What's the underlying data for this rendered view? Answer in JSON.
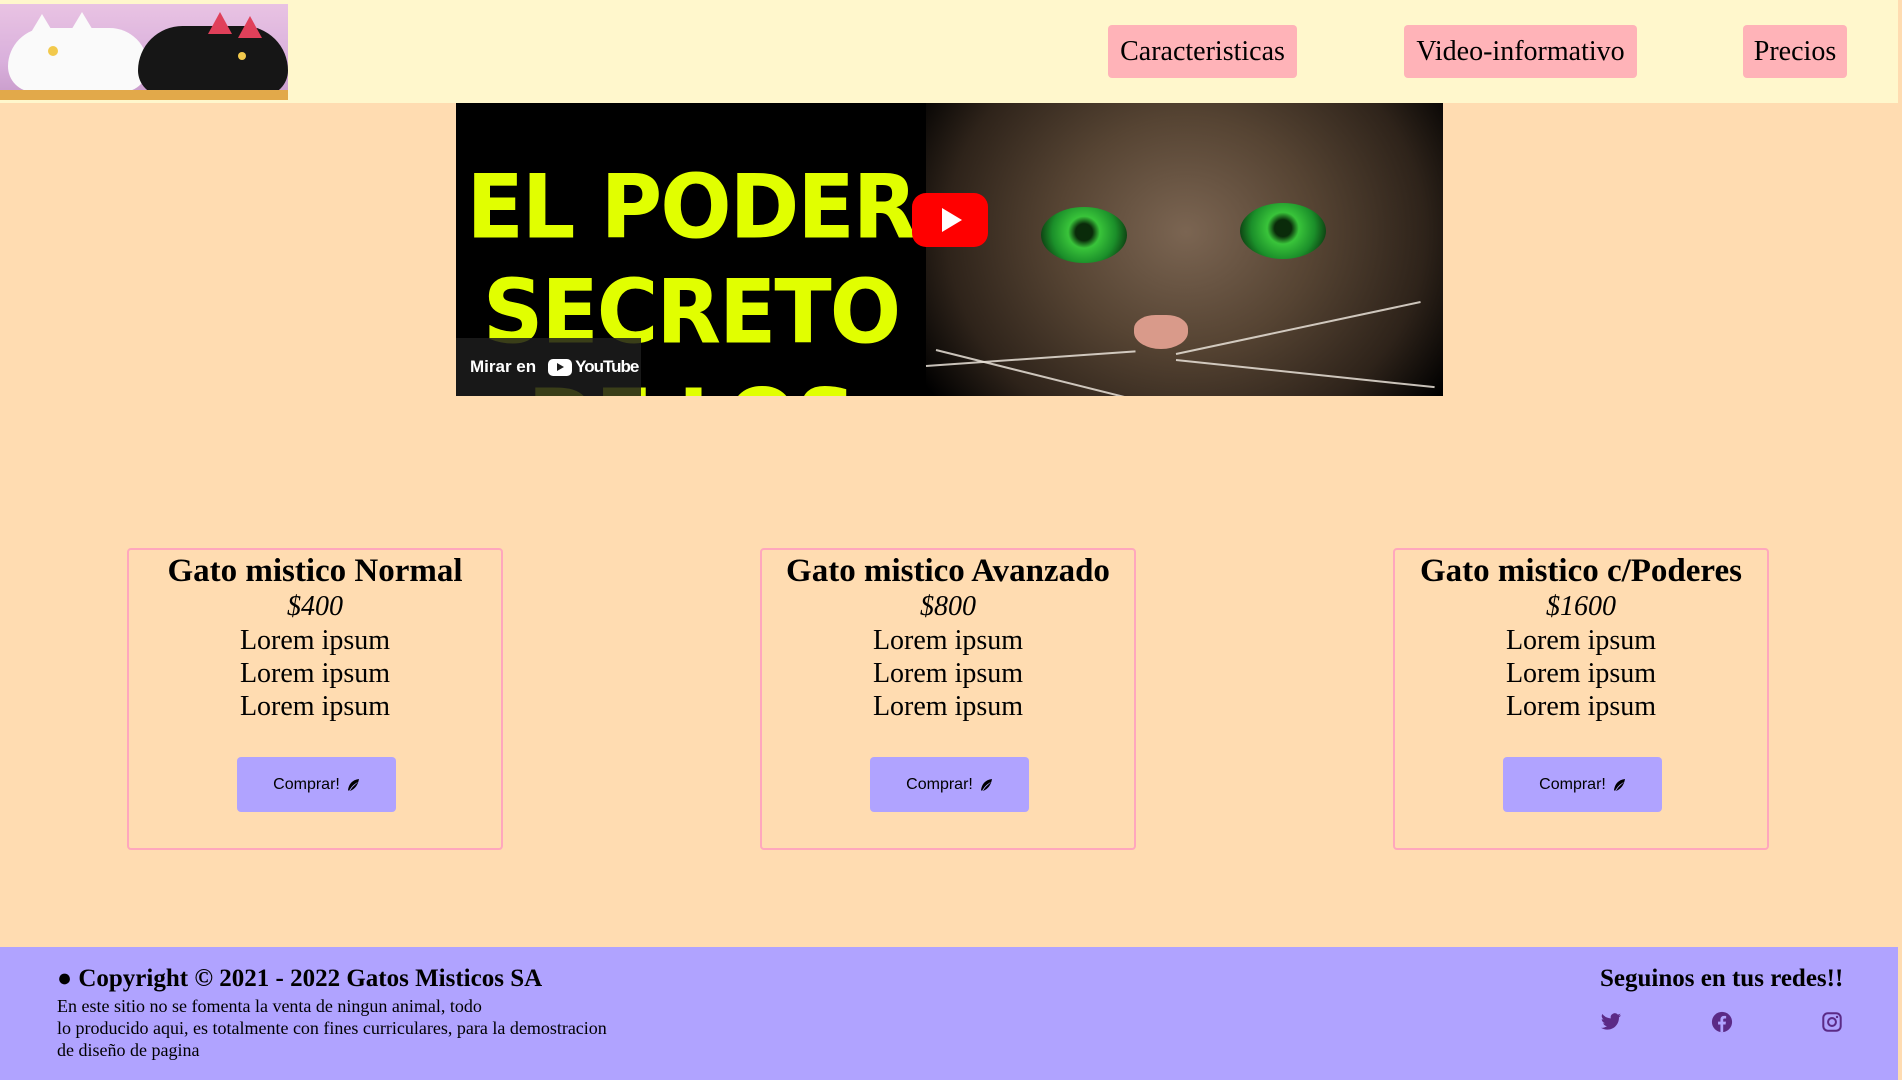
{
  "header": {
    "logo_alt": "logo gatos misticos",
    "nav": [
      {
        "label": "Caracteristicas"
      },
      {
        "label": "Video-informativo"
      },
      {
        "label": "Precios"
      }
    ]
  },
  "video": {
    "title_lines": [
      "EL PODER",
      "SECRETO",
      "DE LOS GATOS"
    ],
    "watch_on": "Mirar en",
    "youtube_wordmark": "YouTube",
    "play_icon": "youtube-play-icon"
  },
  "pricing": [
    {
      "name": "Gato mistico Normal",
      "price": "$400",
      "features": [
        "Lorem ipsum",
        "Lorem ipsum",
        "Lorem ipsum"
      ],
      "button": "Comprar!"
    },
    {
      "name": "Gato mistico Avanzado",
      "price": "$800",
      "features": [
        "Lorem ipsum",
        "Lorem ipsum",
        "Lorem ipsum"
      ],
      "button": "Comprar!"
    },
    {
      "name": "Gato mistico c/Poderes",
      "price": "$1600",
      "features": [
        "Lorem ipsum",
        "Lorem ipsum",
        "Lorem ipsum"
      ],
      "button": "Comprar!"
    }
  ],
  "footer": {
    "copyright": "● Copyright © 2021 - 2022 Gatos Misticos SA",
    "disclaimer_lines": [
      "En este sitio no se fomenta la venta de ningun animal, todo",
      "lo producido aqui, es totalmente con fines curriculares, para la demostracion",
      "de diseño de pagina"
    ],
    "follow": "Seguinos en tus redes!!",
    "social_icons": [
      "twitter-icon",
      "facebook-icon",
      "instagram-icon"
    ]
  },
  "colors": {
    "page_bg": "#ffdcb1",
    "header_bg": "#fff7cc",
    "nav_button": "#ffb3b8",
    "card_border": "#ffa7bd",
    "buy_button": "#b0a3ff",
    "footer_bg": "#b0a3ff",
    "video_text": "#e1ff00",
    "social_icon": "#5b2a86"
  }
}
